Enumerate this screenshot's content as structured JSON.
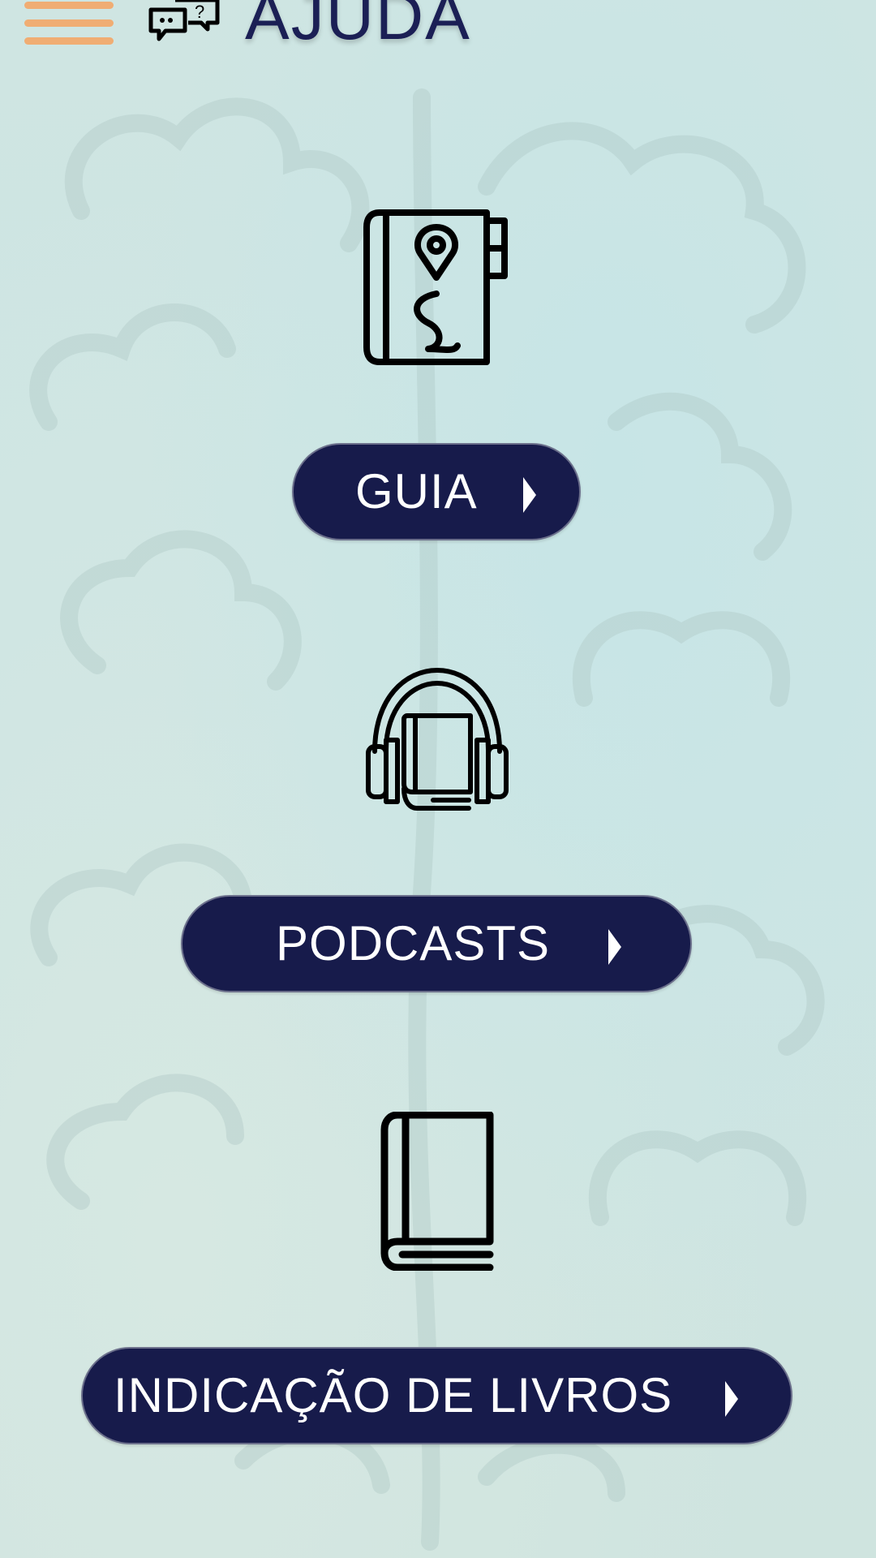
{
  "header": {
    "menu_icon": "hamburger-menu-icon",
    "chat_icon": "chat-bubbles-icon",
    "title": "AJUDA"
  },
  "colors": {
    "background": "#cfe6e4",
    "menu_accent": "#f0ad73",
    "button_fill": "#171b4b",
    "title_color": "#1b1f55",
    "icon_color": "#000000"
  },
  "items": [
    {
      "icon": "map-guide-book-icon",
      "label": "GUIA"
    },
    {
      "icon": "audiobook-headphones-icon",
      "label": "PODCASTS"
    },
    {
      "icon": "book-icon",
      "label": "INDICAÇÃO DE LIVROS"
    }
  ]
}
